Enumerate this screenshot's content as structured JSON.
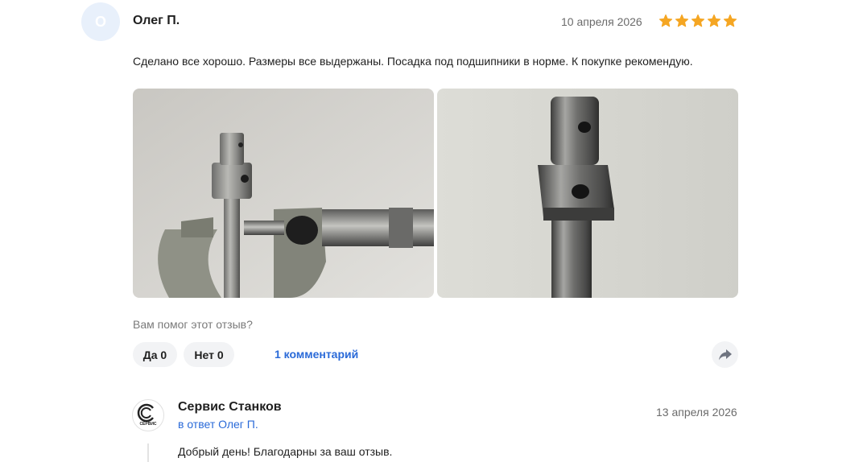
{
  "review": {
    "avatar_letter": "О",
    "author": "Олег П.",
    "date": "10 апреля 2026",
    "rating": 5,
    "rating_max": 5,
    "text": "Сделано все хорошо. Размеры все выдержаны. Посадка под подшипники в норме. К покупке рекомендую.",
    "photos": [
      "photo-micrometer-shaft",
      "photo-shaft-closeup"
    ]
  },
  "feedback": {
    "question": "Вам помог этот отзыв?",
    "yes_label": "Да 0",
    "no_label": "Нет 0",
    "comments_label": "1 комментарий"
  },
  "reply": {
    "seller_name": "Сервис Станков",
    "reply_to": "в ответ Олег П.",
    "date": "13 апреля 2026",
    "text": "Добрый день! Благодарны за ваш отзыв.",
    "logo_text": "СЕРВИС"
  },
  "colors": {
    "star": "#f5a623",
    "link": "#2a6ad8",
    "avatar_bg": "#e8f0fb",
    "button_bg": "#f2f3f5"
  },
  "icons": {
    "share": "share-arrow-icon",
    "star": "star-icon"
  }
}
